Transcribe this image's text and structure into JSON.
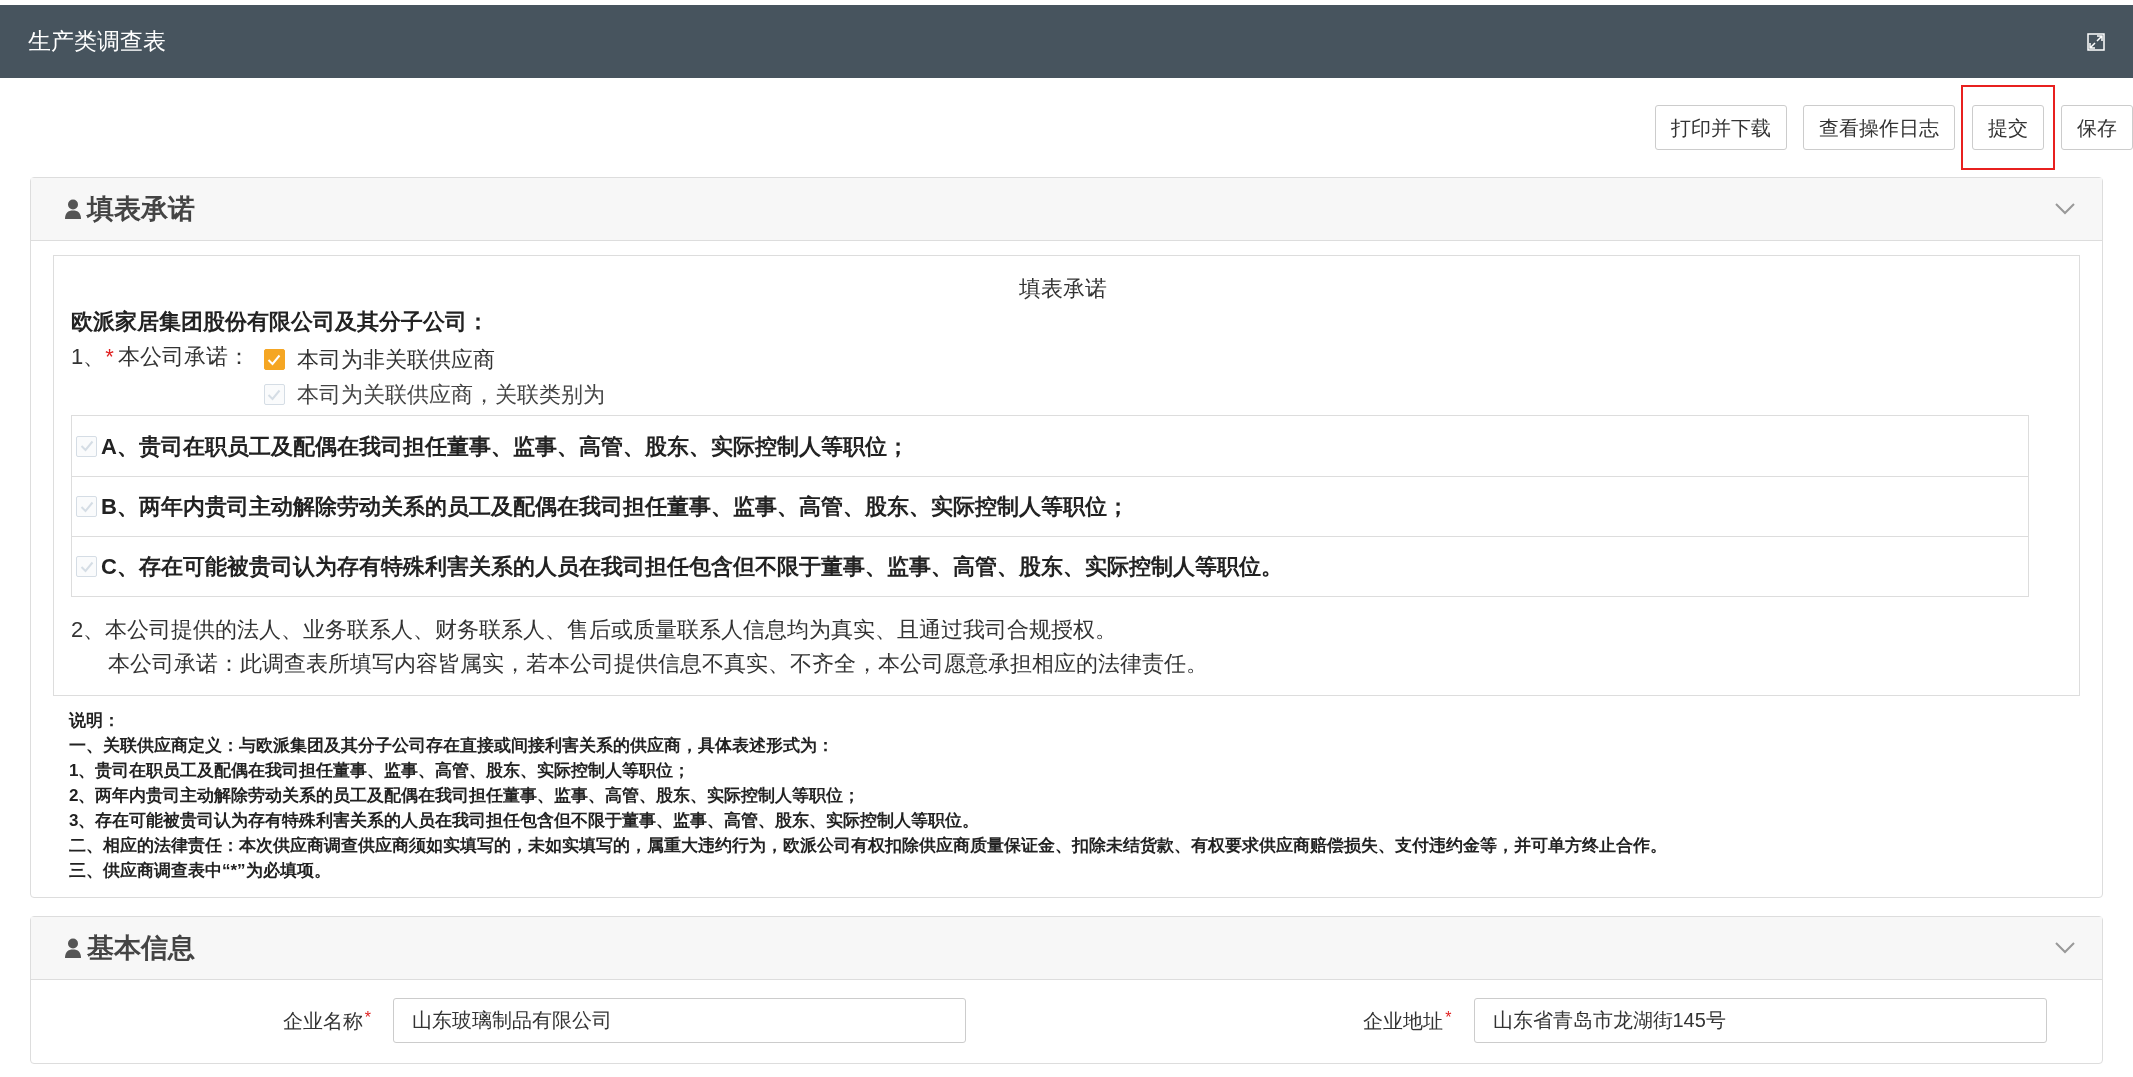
{
  "window": {
    "title": "生产类调查表"
  },
  "toolbar": [
    {
      "label": "打印并下载",
      "highlighted": false
    },
    {
      "label": "查看操作日志",
      "highlighted": false
    },
    {
      "label": "提交",
      "highlighted": true
    },
    {
      "label": "保存",
      "highlighted": false
    }
  ],
  "commitment_panel": {
    "title": "填表承诺",
    "expanded": true,
    "heading": "填表承诺",
    "addressee": "欧派家居集团股份有限公司及其分子公司：",
    "item1": {
      "number": "1、",
      "required_mark": "*",
      "label": "本公司承诺：",
      "options": [
        {
          "label": "本司为非关联供应商",
          "checked": true,
          "disabled": false
        },
        {
          "label": "本司为关联供应商，关联类别为",
          "checked": false,
          "disabled": true
        }
      ]
    },
    "categories": [
      {
        "label": "A、贵司在职员工及配偶在我司担任董事、监事、高管、股东、实际控制人等职位；",
        "checked": false,
        "disabled": true
      },
      {
        "label": "B、两年内贵司主动解除劳动关系的员工及配偶在我司担任董事、监事、高管、股东、实际控制人等职位；",
        "checked": false,
        "disabled": true
      },
      {
        "label": "C、存在可能被贵司认为存有特殊利害关系的人员在我司担任包含但不限于董事、监事、高管、股东、实际控制人等职位。",
        "checked": false,
        "disabled": true
      }
    ],
    "item2": [
      "2、本公司提供的法人、业务联系人、财务联系人、售后或质量联系人信息均为真实、且通过我司合规授权。",
      "本公司承诺：此调查表所填写内容皆属实，若本公司提供信息不真实、不齐全，本公司愿意承担相应的法律责任。"
    ],
    "notes": [
      "说明：",
      "一、关联供应商定义：与欧派集团及其分子公司存在直接或间接利害关系的供应商，具体表述形式为：",
      "1、贵司在职员工及配偶在我司担任董事、监事、高管、股东、实际控制人等职位；",
      "2、两年内贵司主动解除劳动关系的员工及配偶在我司担任董事、监事、高管、股东、实际控制人等职位；",
      "3、存在可能被贵司认为存有特殊利害关系的人员在我司担任包含但不限于董事、监事、高管、股东、实际控制人等职位。",
      "二、相应的法律责任：本次供应商调查供应商须如实填写的，未如实填写的，属重大违约行为，欧派公司有权扣除供应商质量保证金、扣除未结货款、有权要求供应商赔偿损失、支付违约金等，并可单方终止合作。",
      "三、供应商调查表中“*”为必填项。"
    ]
  },
  "basic_info_panel": {
    "title": "基本信息",
    "expanded": true,
    "fields": [
      {
        "label": "企业名称",
        "required_mark": "*",
        "value": "山东玻璃制品有限公司"
      },
      {
        "label": "企业地址",
        "required_mark": "*",
        "value": "山东省青岛市龙湖街145号"
      }
    ]
  }
}
